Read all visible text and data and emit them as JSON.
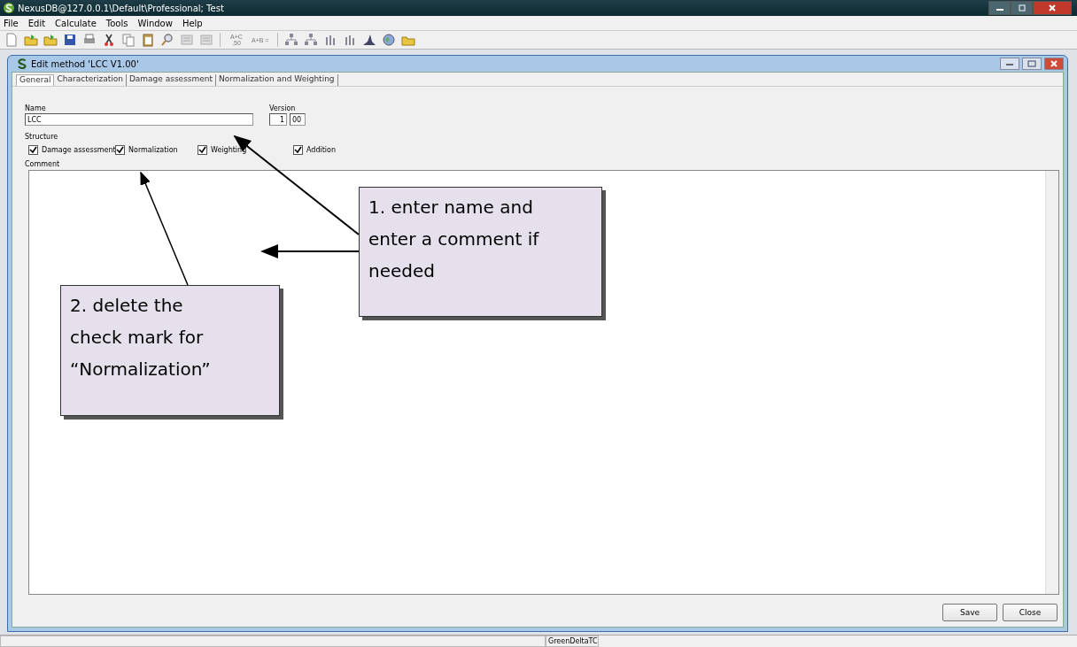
{
  "window": {
    "title": "NexusDB@127.0.0.1\\Default\\Professional; Test"
  },
  "menu": [
    "File",
    "Edit",
    "Calculate",
    "Tools",
    "Window",
    "Help"
  ],
  "toolbar": {
    "text_buttons": [
      "A+C .50",
      "A+B ="
    ]
  },
  "editor": {
    "title": "Edit method 'LCC V1.00'",
    "tabs": [
      {
        "label": "General",
        "selected": true
      },
      {
        "label": "Characterization",
        "selected": false
      },
      {
        "label": "Damage assessment",
        "selected": false
      },
      {
        "label": "Normalization and Weighting",
        "selected": false
      }
    ],
    "name": {
      "label": "Name",
      "value": "LCC"
    },
    "version": {
      "label": "Version",
      "major": "1",
      "minor": "00"
    },
    "structure": {
      "label": "Structure",
      "options": [
        {
          "label": "Damage assessment",
          "checked": true
        },
        {
          "label": "Normalization",
          "checked": true
        },
        {
          "label": "Weighting",
          "checked": true
        },
        {
          "label": "Addition",
          "checked": true
        }
      ]
    },
    "comment": {
      "label": "Comment"
    },
    "buttons": [
      "Save",
      "Close"
    ]
  },
  "status_bar": [
    "GreenDeltaTC"
  ],
  "callouts": [
    "1. enter name and enter a comment if needed",
    "2. delete the check mark for “Normalization”"
  ]
}
